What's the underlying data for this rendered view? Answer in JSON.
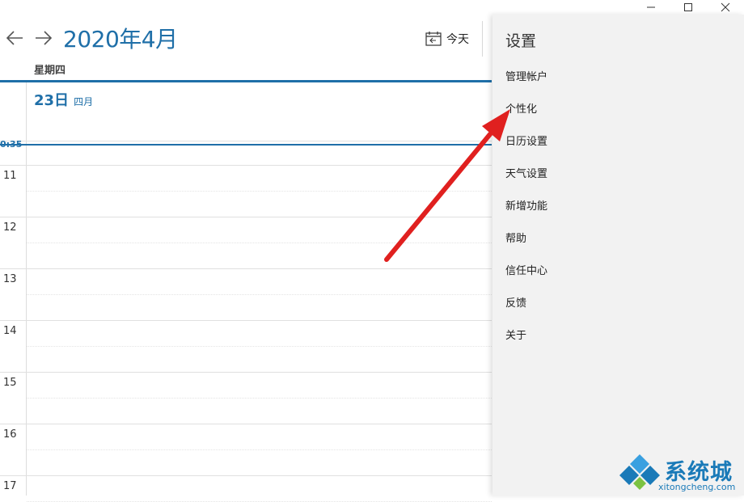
{
  "window_controls": {
    "minimize_icon": "minimize-icon",
    "maximize_icon": "maximize-icon",
    "close_icon": "close-icon"
  },
  "nav": {
    "month_title": "2020年4月",
    "today_label": "今天"
  },
  "day": {
    "weekday": "星期四",
    "date_num": "23日",
    "date_month": "四月",
    "now_time": "0:35"
  },
  "hours": [
    "11",
    "12",
    "13",
    "14",
    "15",
    "16",
    "17"
  ],
  "settings": {
    "title": "设置",
    "items": [
      "管理帐户",
      "个性化",
      "日历设置",
      "天气设置",
      "新增功能",
      "帮助",
      "信任中心",
      "反馈",
      "关于"
    ]
  },
  "colors": {
    "accent": "#1f6fa8",
    "annotation_arrow": "#e0201f",
    "panel_bg": "#f2f2f2"
  },
  "watermark": {
    "text": "系统城",
    "url": "xitongcheng.com"
  }
}
